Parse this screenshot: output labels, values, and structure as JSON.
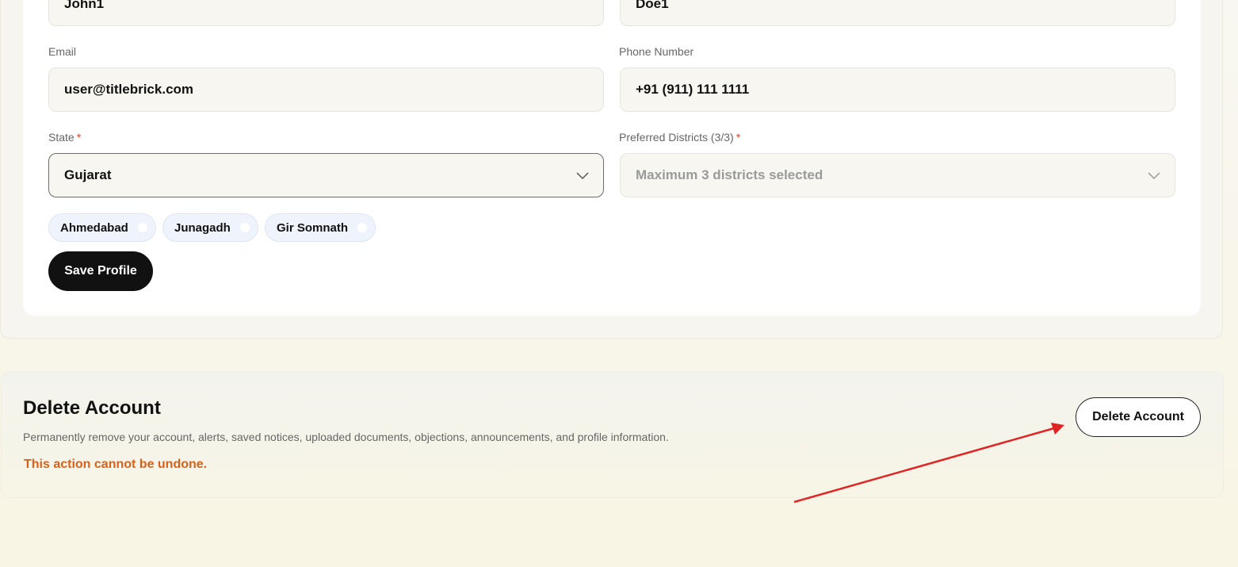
{
  "profile_form": {
    "first_name": {
      "value": "John1"
    },
    "last_name": {
      "value": "Doe1"
    },
    "email": {
      "label": "Email",
      "value": "user@titlebrick.com"
    },
    "phone": {
      "label": "Phone Number",
      "value": "+91 (911) 111 1111"
    },
    "state": {
      "label": "State",
      "required_mark": "*",
      "value": "Gujarat"
    },
    "districts": {
      "label": "Preferred Districts (3/3)",
      "required_mark": "*",
      "placeholder": "Maximum 3 districts selected",
      "selected": [
        "Ahmedabad",
        "Junagadh",
        "Gir Somnath"
      ]
    },
    "save_label": "Save Profile"
  },
  "delete_account": {
    "title": "Delete Account",
    "description": "Permanently remove your account, alerts, saved notices, uploaded documents, objections, announcements, and profile information.",
    "warning": "This action cannot be undone.",
    "button_label": "Delete Account"
  },
  "colors": {
    "required": "#e0483c",
    "warning": "#d8621c",
    "annotation_arrow": "#e02424",
    "primary_button": "#111111"
  },
  "icons": {
    "select_chevron": "chevron-down-icon",
    "chip_remove": "chip-remove-icon",
    "annotation": "red-arrow-annotation"
  }
}
